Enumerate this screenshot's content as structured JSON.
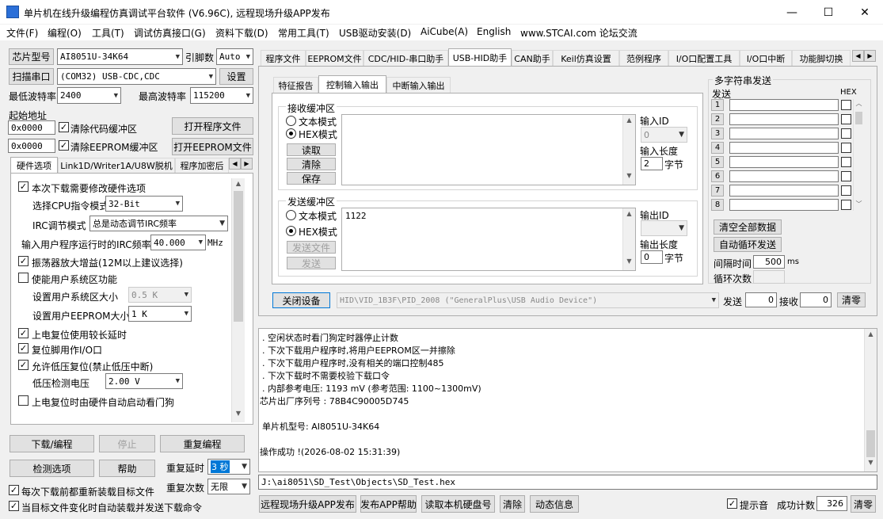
{
  "window": {
    "title": "单片机在线升级编程仿真调试平台软件 (V6.96C), 远程现场升级APP发布",
    "min_icon": "—",
    "max_icon": "☐",
    "close_icon": "✕"
  },
  "menu": [
    "文件(F)",
    "编程(O)",
    "工具(T)",
    "调试仿真接口(G)",
    "资料下载(D)",
    "常用工具(T)",
    "USB驱动安装(D)",
    "AiCube(A)",
    "English",
    "www.STCAI.com 论坛交流"
  ],
  "left": {
    "chip_label": "芯片型号",
    "chip_value": "AI8051U-34K64",
    "pins_label": "引脚数",
    "pins_value": "Auto",
    "scan_label": "扫描串口",
    "port_value": "(COM32) USB-CDC,CDC",
    "settings_label": "设置",
    "min_baud_label": "最低波特率",
    "min_baud_value": "2400",
    "max_baud_label": "最高波特率",
    "max_baud_value": "115200",
    "start_addr_label": "起始地址",
    "addr1": "0x0000",
    "clear_code_label": "清除代码缓冲区",
    "open_prog_label": "打开程序文件",
    "addr2": "0x0000",
    "clear_eeprom_label": "清除EEPROM缓冲区",
    "open_eeprom_label": "打开EEPROM文件",
    "tabs": [
      "硬件选项",
      "Link1D/Writer1A/U8W脱机",
      "程序加密后"
    ],
    "hw": {
      "modify_hw": "本次下载需要修改硬件选项",
      "cpu_label": "选择CPU指令模式",
      "cpu_value": "32-Bit",
      "irc_label": "IRC调节模式",
      "irc_value": "总是动态调节IRC频率",
      "freq_label": "输入用户程序运行时的IRC频率",
      "freq_value": "40.000",
      "freq_unit": "MHz",
      "osc_gain": "振荡器放大增益(12M以上建议选择)",
      "user_sys": "使能用户系统区功能",
      "sys_size_label": "设置用户系统区大小",
      "sys_size_value": "0.5 K",
      "eeprom_size_label": "设置用户EEPROM大小",
      "eeprom_size_value": "1  K",
      "power_delay": "上电复位使用较长延时",
      "reset_io": "复位脚用作I/O口",
      "low_volt_reset": "允许低压复位(禁止低压中断)",
      "low_volt_label": "低压检测电压",
      "low_volt_value": "2.00 V",
      "wdt_auto": "上电复位时由硬件自动启动看门狗"
    },
    "download_label": "下载/编程",
    "stop_label": "停止",
    "reprog_label": "重复编程",
    "detect_label": "检测选项",
    "help_label": "帮助",
    "repeat_delay_label": "重复延时",
    "repeat_delay_value": "3 秒",
    "repeat_count_label": "重复次数",
    "repeat_count_value": "无限",
    "reload_before": "每次下载前都重新装载目标文件",
    "auto_reload": "当目标文件变化时自动装载并发送下载命令"
  },
  "right_tabs": [
    "程序文件",
    "EEPROM文件",
    "CDC/HID-串口助手",
    "USB-HID助手",
    "CAN助手",
    "Keil仿真设置",
    "范例程序",
    "I/O口配置工具",
    "I/O口中断",
    "功能脚切换"
  ],
  "hid": {
    "subtabs": [
      "特征报告",
      "控制输入输出",
      "中断输入输出"
    ],
    "recv_group": "接收缓冲区",
    "text_mode": "文本模式",
    "hex_mode": "HEX模式",
    "read": "读取",
    "clear": "清除",
    "save": "保存",
    "in_id_label": "输入ID",
    "in_id_value": "0",
    "in_len_label": "输入长度",
    "in_len_value": "2",
    "byte_unit": "字节",
    "send_group": "发送缓冲区",
    "send_text_mode": "文本模式",
    "send_hex_mode": "HEX模式",
    "send_file": "发送文件",
    "send": "发送",
    "send_content": "1122",
    "out_id_label": "输出ID",
    "out_len_label": "输出长度",
    "out_len_value": "0",
    "close_device": "关闭设备",
    "device_path": "HID\\VID_1B3F\\PID_2008 (\"GeneralPlus\\USB Audio Device\")",
    "send_count_label": "发送",
    "send_count": "0",
    "recv_count_label": "接收",
    "recv_count": "0",
    "clear_count": "清零"
  },
  "multi": {
    "title": "多字符串发送",
    "send_col": "发送",
    "hex_col": "HEX",
    "rows": [
      "1",
      "2",
      "3",
      "4",
      "5",
      "6",
      "7",
      "8"
    ],
    "clear_all": "清空全部数据",
    "auto_loop": "自动循环发送",
    "interval_label": "间隔时间",
    "interval_value": "500",
    "interval_unit": "ms",
    "loop_label": "循环次数"
  },
  "log": [
    "  . 空闲状态时看门狗定时器停止计数",
    "  . 下次下载用户程序时,将用户EEPROM区一并擦除",
    "  . 下次下载用户程序时,没有相关的端口控制485",
    "  . 下次下载时不需要校验下载口令",
    "  . 内部参考电压: 1193 mV (参考范围: 1100~1300mV)",
    "芯片出厂序列号 : 78B4C90005D745",
    "",
    "  单片机型号: AI8051U-34K64",
    "",
    "操作成功 !(2026-08-02 15:31:39)"
  ],
  "file_path": "J:\\ai8051\\SD_Test\\Objects\\SD_Test.hex",
  "bottom": {
    "publish": "远程现场升级APP发布",
    "publish_help": "发布APP帮助",
    "read_disk": "读取本机硬盘号",
    "clear": "清除",
    "dynamic": "动态信息",
    "beep": "提示音",
    "success_label": "成功计数",
    "success_count": "326",
    "reset": "清零"
  }
}
